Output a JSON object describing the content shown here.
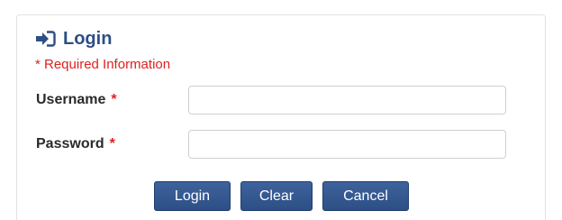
{
  "form": {
    "title": "Login",
    "title_icon": "sign-in-icon",
    "required_note": "* Required Information",
    "fields": {
      "username": {
        "label": "Username",
        "required_marker": "*",
        "value": "",
        "placeholder": ""
      },
      "password": {
        "label": "Password",
        "required_marker": "*",
        "value": "",
        "placeholder": ""
      }
    },
    "buttons": {
      "login": "Login",
      "clear": "Clear",
      "cancel": "Cancel"
    }
  },
  "colors": {
    "title": "#2c4f86",
    "required": "#e02020",
    "button": "#2d4f86",
    "button_text": "#ffffff"
  }
}
